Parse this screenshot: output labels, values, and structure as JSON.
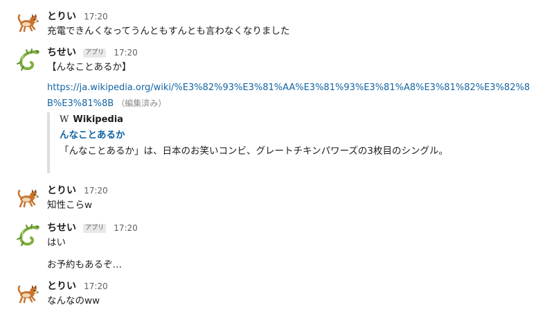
{
  "messages": [
    {
      "user": "とりい",
      "time": "17:20",
      "text": "充電できんくなってうんともすんとも言わなくなりました"
    },
    {
      "user": "ちせい",
      "badge": "アプリ",
      "time": "17:20",
      "text": "【んなことあるか】",
      "url": "https://ja.wikipedia.org/wiki/%E3%82%93%E3%81%AA%E3%81%93%E3%81%A8%E3%81%82%E3%82%8B%E3%81%8B",
      "edited": "（編集済み）",
      "attachment": {
        "service_logo": "W",
        "service": "Wikipedia",
        "title": "んなことあるか",
        "description": "「んなことあるか」は、日本のお笑いコンビ、グレートチキンパワーズの3枚目のシングル。"
      }
    },
    {
      "user": "とりい",
      "time": "17:20",
      "text": "知性こらw"
    },
    {
      "user": "ちせい",
      "badge": "アプリ",
      "time": "17:20",
      "text": "はい",
      "followup": "お予約もあるぞ…"
    },
    {
      "user": "とりい",
      "time": "17:20",
      "text": "なんなのww"
    }
  ],
  "icons": {
    "torii_avatar": "dog-avatar-icon",
    "chisei_avatar": "lizard-avatar-icon"
  },
  "colors": {
    "link": "#1264a3",
    "text": "#1d1c1d",
    "muted": "#616061",
    "attachment_bar": "#dddddd"
  }
}
